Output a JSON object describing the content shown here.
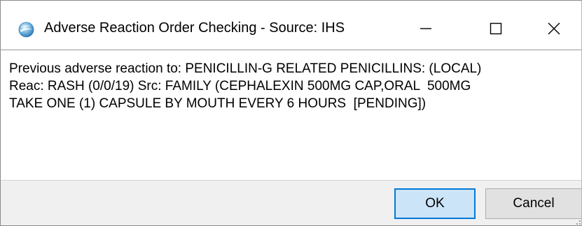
{
  "window": {
    "title": "Adverse Reaction Order Checking - Source: IHS",
    "icon": "globe-icon",
    "controls": {
      "minimize_icon": "minimize-icon",
      "maximize_icon": "maximize-icon",
      "close_icon": "close-icon"
    }
  },
  "message": {
    "lines": [
      "Previous adverse reaction to: PENICILLIN-G RELATED PENICILLINS: (LOCAL)",
      "Reac: RASH (0/0/19) Src: FAMILY (CEPHALEXIN 500MG CAP,ORAL  500MG",
      "TAKE ONE (1) CAPSULE BY MOUTH EVERY 6 HOURS  [PENDING])"
    ]
  },
  "buttons": {
    "ok_label": "OK",
    "cancel_label": "Cancel"
  },
  "colors": {
    "ok_button_bg": "#cce4f7",
    "ok_button_border": "#0078d7",
    "footer_bg": "#f0f0f0"
  }
}
